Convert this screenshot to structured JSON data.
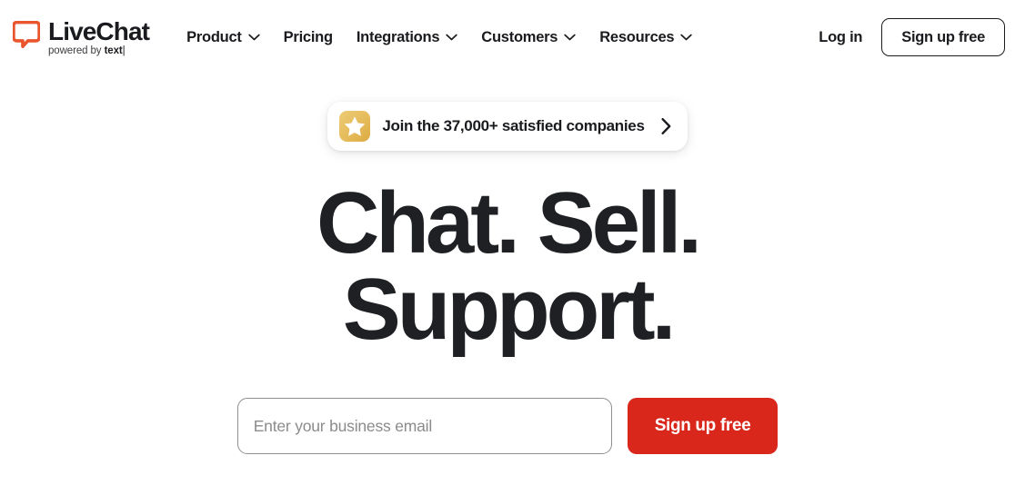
{
  "brand": {
    "logo_icon": "speech-bubble-icon",
    "name": "LiveChat",
    "tagline_prefix": "powered by ",
    "tagline_brand": "text",
    "tagline_caret": "|",
    "logo_color": "#e9552d"
  },
  "nav": {
    "items": [
      {
        "label": "Product",
        "has_dropdown": true,
        "icon": "chevron-down-icon"
      },
      {
        "label": "Pricing",
        "has_dropdown": false,
        "icon": ""
      },
      {
        "label": "Integrations",
        "has_dropdown": true,
        "icon": "chevron-down-icon"
      },
      {
        "label": "Customers",
        "has_dropdown": true,
        "icon": "chevron-down-icon"
      },
      {
        "label": "Resources",
        "has_dropdown": true,
        "icon": "chevron-down-icon"
      }
    ]
  },
  "header_actions": {
    "login_label": "Log in",
    "signup_label": "Sign up free"
  },
  "hero": {
    "badge": {
      "icon": "star-icon",
      "label": "Join the 37,000+ satisfied companies",
      "arrow_icon": "chevron-right-icon",
      "star_color": "#e3b449"
    },
    "headline_lines": [
      "Chat. Sell.",
      "Support."
    ],
    "form": {
      "email_placeholder": "Enter your business email",
      "email_value": "",
      "cta_label": "Sign up free",
      "cta_color": "#d9271c"
    }
  }
}
